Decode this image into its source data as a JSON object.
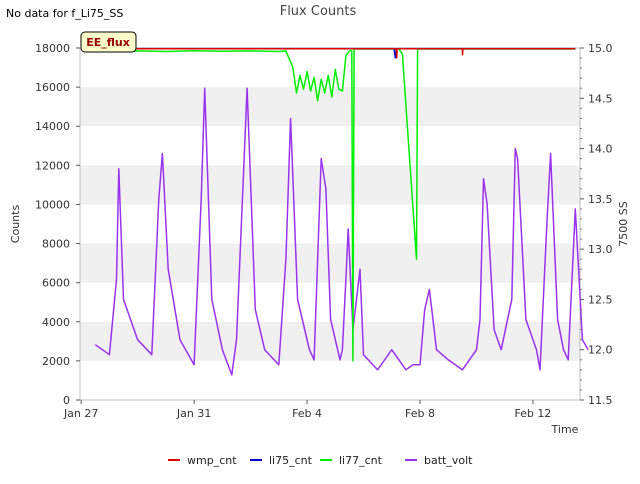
{
  "figure": {
    "no_data_note": "No data for f_Li75_SS",
    "site_badge": "EE_flux"
  },
  "chart_data": {
    "type": "line",
    "title": "Flux Counts",
    "xlabel": "Time",
    "ylabel": "Counts",
    "y2label": "7500 SS",
    "x_range": [
      "2018-01-26T23:00",
      "2018-02-13T16:00"
    ],
    "ylim": [
      0,
      18000
    ],
    "y2lim": [
      11.5,
      15.0
    ],
    "x_ticks": [
      {
        "date": "2018-01-27",
        "label": "Jan 27"
      },
      {
        "date": "2018-01-31",
        "label": "Jan 31"
      },
      {
        "date": "2018-02-04",
        "label": "Feb 4"
      },
      {
        "date": "2018-02-08",
        "label": "Feb 8"
      },
      {
        "date": "2018-02-12",
        "label": "Feb 12"
      }
    ],
    "y_ticks": [
      "0",
      "2000",
      "4000",
      "6000",
      "8000",
      "10000",
      "12000",
      "14000",
      "16000",
      "18000"
    ],
    "y2_ticks": [
      "11.5",
      "12.0",
      "12.5",
      "13.0",
      "13.5",
      "14.0",
      "14.5",
      "15.0"
    ],
    "grid": "horizontal bands",
    "legend_position": "bottom",
    "series": [
      {
        "name": "wmp_cnt",
        "color": "#dd0000",
        "axis": "left",
        "points": [
          [
            "2018-01-27T12:00",
            17960
          ],
          [
            "2018-02-06T00:00",
            17960
          ],
          [
            "2018-02-07T04:00",
            17960
          ],
          [
            "2018-02-07T04:10",
            17500
          ],
          [
            "2018-02-07T04:30",
            17960
          ],
          [
            "2018-02-09T12:00",
            17960
          ],
          [
            "2018-02-09T12:10",
            17650
          ],
          [
            "2018-02-09T12:30",
            17960
          ],
          [
            "2018-02-13T12:00",
            17960
          ]
        ]
      },
      {
        "name": "li75_cnt",
        "color": "#0000cc",
        "axis": "left",
        "points": [
          [
            "2018-01-27T12:00",
            17970
          ],
          [
            "2018-02-07T02:00",
            17970
          ],
          [
            "2018-02-07T03:00",
            17500
          ],
          [
            "2018-02-07T04:00",
            17970
          ],
          [
            "2018-02-13T12:00",
            17970
          ]
        ]
      },
      {
        "name": "li77_cnt",
        "color": "#00ee00",
        "axis": "left",
        "points": [
          [
            "2018-01-27T12:00",
            17850
          ],
          [
            "2018-01-28T00:00",
            17800
          ],
          [
            "2018-01-29T00:00",
            17850
          ],
          [
            "2018-01-30T00:00",
            17820
          ],
          [
            "2018-01-31T00:00",
            17860
          ],
          [
            "2018-02-01T00:00",
            17830
          ],
          [
            "2018-02-02T00:00",
            17850
          ],
          [
            "2018-02-03T00:00",
            17820
          ],
          [
            "2018-02-03T06:00",
            17850
          ],
          [
            "2018-02-03T12:00",
            17000
          ],
          [
            "2018-02-03T15:00",
            15700
          ],
          [
            "2018-02-03T18:00",
            16600
          ],
          [
            "2018-02-03T21:00",
            15900
          ],
          [
            "2018-02-04T00:00",
            16800
          ],
          [
            "2018-02-04T03:00",
            15800
          ],
          [
            "2018-02-04T06:00",
            16500
          ],
          [
            "2018-02-04T09:00",
            15300
          ],
          [
            "2018-02-04T12:00",
            16400
          ],
          [
            "2018-02-04T15:00",
            15700
          ],
          [
            "2018-02-04T18:00",
            16600
          ],
          [
            "2018-02-04T21:00",
            15500
          ],
          [
            "2018-02-05T00:00",
            16900
          ],
          [
            "2018-02-05T03:00",
            15900
          ],
          [
            "2018-02-05T06:00",
            15800
          ],
          [
            "2018-02-05T09:00",
            17600
          ],
          [
            "2018-02-05T12:00",
            17850
          ],
          [
            "2018-02-05T14:00",
            17850
          ],
          [
            "2018-02-05T15:00",
            2000
          ],
          [
            "2018-02-05T16:00",
            17950
          ],
          [
            "2018-02-06T00:00",
            17950
          ],
          [
            "2018-02-07T00:00",
            17950
          ],
          [
            "2018-02-07T06:00",
            17950
          ],
          [
            "2018-02-07T09:00",
            17700
          ],
          [
            "2018-02-07T21:00",
            7200
          ],
          [
            "2018-02-07T22:00",
            17950
          ],
          [
            "2018-02-08T12:00",
            17950
          ],
          [
            "2018-02-10T00:00",
            17950
          ],
          [
            "2018-02-13T12:00",
            17950
          ]
        ]
      },
      {
        "name": "batt_volt",
        "color": "#9933ee",
        "axis": "right",
        "points": [
          [
            "2018-01-27T12:00",
            12.05
          ],
          [
            "2018-01-28T00:00",
            11.95
          ],
          [
            "2018-01-28T06:00",
            12.7
          ],
          [
            "2018-01-28T08:00",
            13.8
          ],
          [
            "2018-01-28T12:00",
            12.5
          ],
          [
            "2018-01-29T00:00",
            12.1
          ],
          [
            "2018-01-29T12:00",
            11.95
          ],
          [
            "2018-01-29T18:00",
            13.5
          ],
          [
            "2018-01-29T21:00",
            13.95
          ],
          [
            "2018-01-30T02:00",
            12.8
          ],
          [
            "2018-01-30T12:00",
            12.1
          ],
          [
            "2018-01-31T00:00",
            11.85
          ],
          [
            "2018-01-31T06:00",
            13.5
          ],
          [
            "2018-01-31T09:00",
            14.6
          ],
          [
            "2018-01-31T15:00",
            12.5
          ],
          [
            "2018-02-01T00:00",
            12.0
          ],
          [
            "2018-02-01T08:00",
            11.75
          ],
          [
            "2018-02-01T12:00",
            12.1
          ],
          [
            "2018-02-01T21:00",
            14.6
          ],
          [
            "2018-02-02T04:00",
            12.4
          ],
          [
            "2018-02-02T12:00",
            12.0
          ],
          [
            "2018-02-03T00:00",
            11.85
          ],
          [
            "2018-02-03T06:00",
            12.9
          ],
          [
            "2018-02-03T10:00",
            14.3
          ],
          [
            "2018-02-03T16:00",
            12.5
          ],
          [
            "2018-02-04T02:00",
            12.0
          ],
          [
            "2018-02-04T06:00",
            11.9
          ],
          [
            "2018-02-04T12:00",
            13.9
          ],
          [
            "2018-02-04T16:00",
            13.6
          ],
          [
            "2018-02-04T20:00",
            12.3
          ],
          [
            "2018-02-05T04:00",
            11.9
          ],
          [
            "2018-02-05T06:00",
            12.0
          ],
          [
            "2018-02-05T09:00",
            12.7
          ],
          [
            "2018-02-05T11:00",
            13.2
          ],
          [
            "2018-02-05T15:00",
            12.2
          ],
          [
            "2018-02-05T21:00",
            12.8
          ],
          [
            "2018-02-06T00:00",
            11.95
          ],
          [
            "2018-02-06T12:00",
            11.8
          ],
          [
            "2018-02-07T00:00",
            12.0
          ],
          [
            "2018-02-07T12:00",
            11.8
          ],
          [
            "2018-02-07T18:00",
            11.85
          ],
          [
            "2018-02-08T00:00",
            11.85
          ],
          [
            "2018-02-08T04:00",
            12.4
          ],
          [
            "2018-02-08T08:00",
            12.6
          ],
          [
            "2018-02-08T14:00",
            12.0
          ],
          [
            "2018-02-09T00:00",
            11.9
          ],
          [
            "2018-02-09T12:00",
            11.8
          ],
          [
            "2018-02-10T00:00",
            12.0
          ],
          [
            "2018-02-10T03:00",
            12.3
          ],
          [
            "2018-02-10T06:00",
            13.7
          ],
          [
            "2018-02-10T09:00",
            13.45
          ],
          [
            "2018-02-10T15:00",
            12.2
          ],
          [
            "2018-02-10T21:00",
            12.0
          ],
          [
            "2018-02-11T06:00",
            12.5
          ],
          [
            "2018-02-11T09:00",
            14.0
          ],
          [
            "2018-02-11T11:00",
            13.9
          ],
          [
            "2018-02-11T18:00",
            12.3
          ],
          [
            "2018-02-12T03:00",
            12.0
          ],
          [
            "2018-02-12T06:00",
            11.8
          ],
          [
            "2018-02-12T12:00",
            13.3
          ],
          [
            "2018-02-12T15:00",
            13.95
          ],
          [
            "2018-02-12T21:00",
            12.3
          ],
          [
            "2018-02-13T02:00",
            12.0
          ],
          [
            "2018-02-13T06:00",
            11.9
          ],
          [
            "2018-02-13T12:00",
            13.4
          ],
          [
            "2018-02-13T18:00",
            12.1
          ],
          [
            "2018-02-13T23:00",
            12.0
          ]
        ]
      }
    ]
  },
  "colors": {
    "band": "#f0f0f0",
    "badge_fill": "#ffffcc",
    "badge_text": "#990000"
  }
}
